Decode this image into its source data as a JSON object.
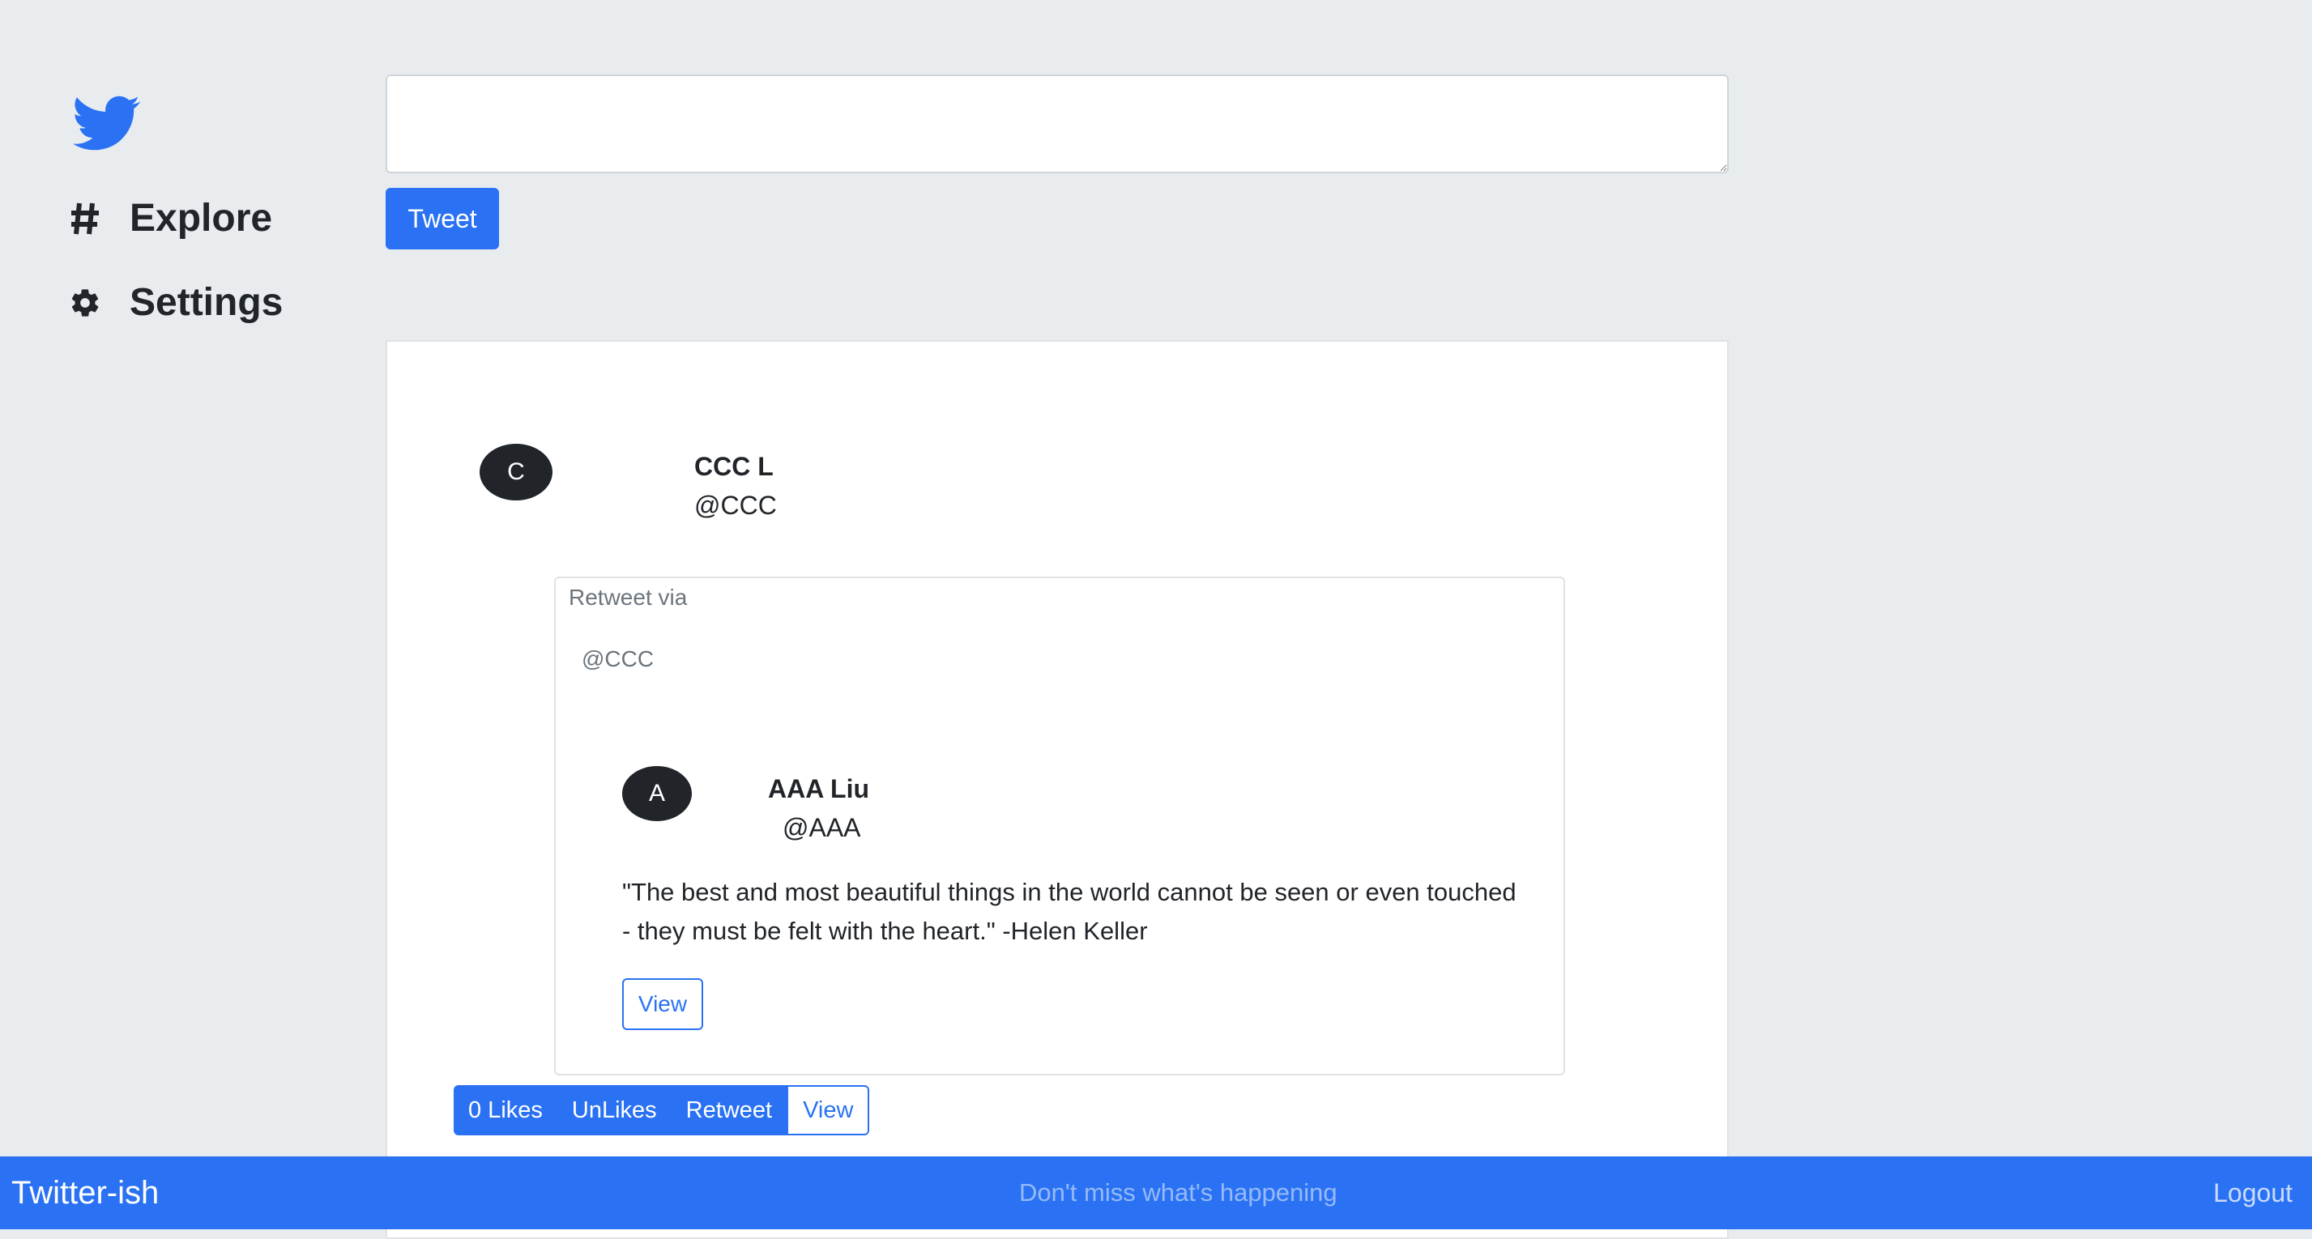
{
  "sidebar": {
    "logo_icon": "twitter-bird-icon",
    "items": [
      {
        "label": "Explore",
        "icon": "hash-icon"
      },
      {
        "label": "Settings",
        "icon": "gear-icon"
      }
    ]
  },
  "composer": {
    "value": "",
    "tweet_label": "Tweet"
  },
  "feed": {
    "post": {
      "avatar_letter": "C",
      "name": "CCC L",
      "handle": "@CCC",
      "retweet": {
        "label": "Retweet via",
        "via_handle": "@CCC",
        "original": {
          "avatar_letter": "A",
          "name": "AAA Liu",
          "handle": "@AAA",
          "text": "\"The best and most beautiful things in the world cannot be seen or even touched - they must be felt with the heart.\" -Helen Keller",
          "view_label": "View"
        }
      },
      "actions": {
        "likes": "0 Likes",
        "unlikes": "UnLikes",
        "retweet": "Retweet",
        "view": "View"
      }
    }
  },
  "bottombar": {
    "brand": "Twitter-ish",
    "tagline": "Don't miss what's happening",
    "logout": "Logout"
  },
  "colors": {
    "accent": "#2a72f3",
    "background": "#e8ecef",
    "dark": "#212529"
  }
}
